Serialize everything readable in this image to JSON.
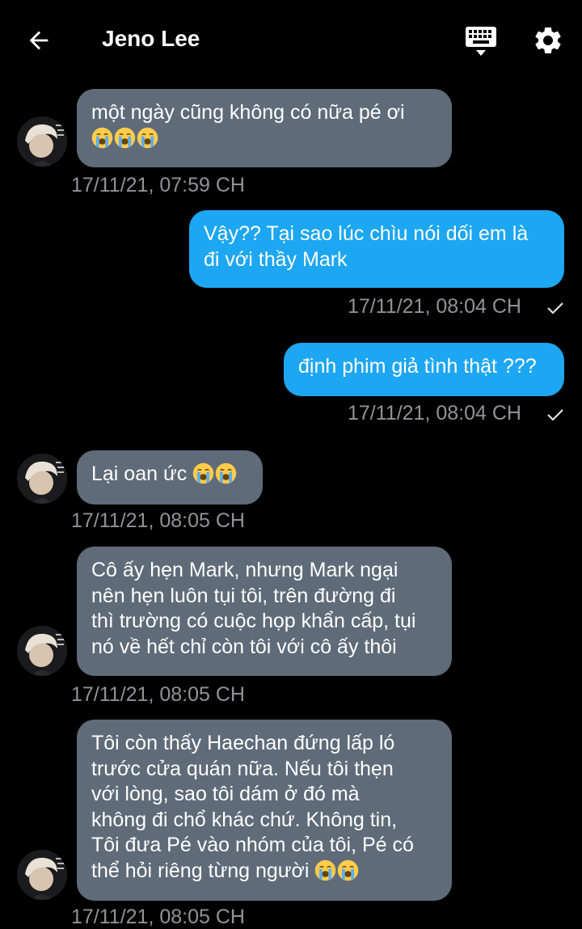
{
  "header": {
    "title": "Jeno Lee",
    "back_icon": "arrow-left-icon",
    "keyboard_icon": "keyboard-icon",
    "settings_icon": "gear-icon"
  },
  "colors": {
    "background": "#000000",
    "incoming_bubble": "#5f6b78",
    "outgoing_bubble": "#1da6f2",
    "timestamp": "#8f9399"
  },
  "messages": [
    {
      "direction": "in",
      "text": "một ngày cũng không có nữa pé ơi",
      "emojis": 3,
      "timestamp": "17/11/21, 07:59 CH"
    },
    {
      "direction": "out",
      "text": "Vậy?? Tại sao lúc chìu nói dối em là\nđi với thầy Mark",
      "timestamp": "17/11/21, 08:04 CH",
      "status": "sent"
    },
    {
      "direction": "out",
      "text": "định phim giả tình thật ???",
      "timestamp": "17/11/21, 08:04 CH",
      "status": "sent"
    },
    {
      "direction": "in",
      "text": "Lại oan ức",
      "emojis": 2,
      "timestamp": "17/11/21, 08:05 CH"
    },
    {
      "direction": "in",
      "text": "Cô ấy hẹn Mark, nhưng Mark ngại\nnên hẹn luôn tụi tôi, trên đường đi\nthì trường có cuộc họp khẩn cấp, tụi\nnó về hết chỉ còn tôi với cô ấy thôi",
      "timestamp": "17/11/21, 08:05 CH"
    },
    {
      "direction": "in",
      "text": "Tôi còn thấy Haechan đứng lấp ló\ntrước cửa quán nữa. Nếu tôi thẹn\nvới lòng, sao tôi dám ở đó mà\nkhông đi chổ khác chứ. Không tin,\nTôi đưa Pé vào nhóm của tôi, Pé có\nthể hỏi riêng từng người",
      "emojis": 2,
      "timestamp": "17/11/21, 08:05 CH"
    }
  ]
}
